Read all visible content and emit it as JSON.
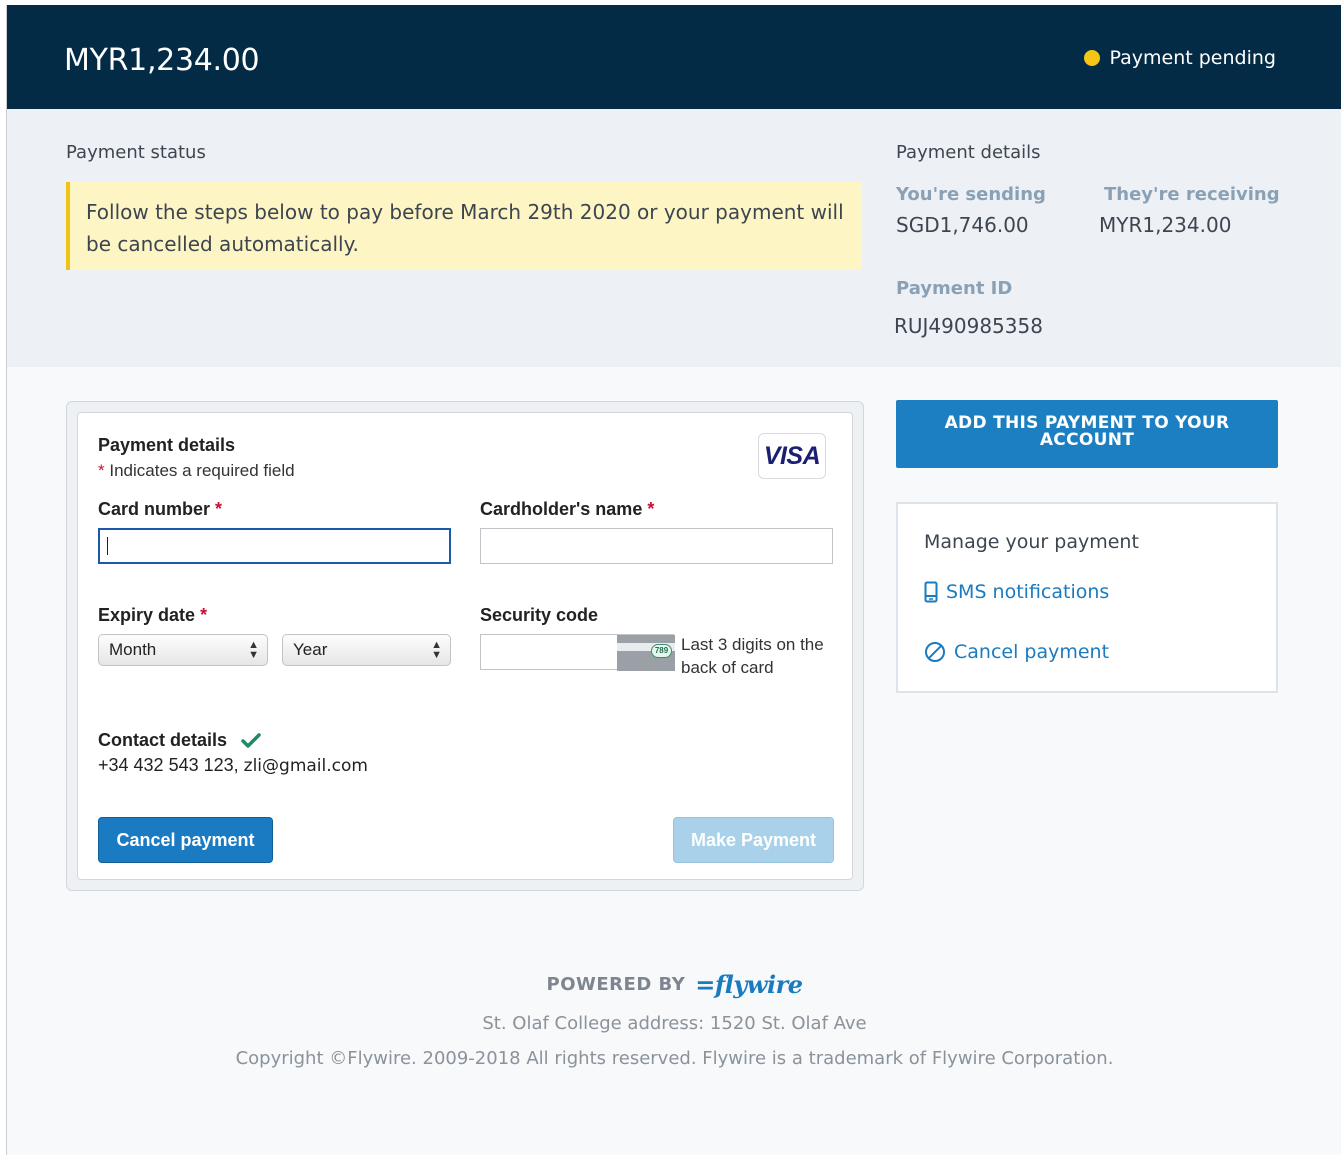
{
  "header": {
    "amount": "MYR1,234.00",
    "status": "Payment pending",
    "status_color": "#f5c518"
  },
  "summary": {
    "status_label": "Payment status",
    "notice": "Follow the steps below to pay before March 29th 2020 or your payment will be cancelled automatically.",
    "details_title": "Payment details",
    "sending_label": "You're sending",
    "sending_value": "SGD1,746.00",
    "receiving_label": "They're receiving",
    "receiving_value": "MYR1,234.00",
    "id_label": "Payment ID",
    "id_value": "RUJ490985358"
  },
  "form": {
    "title": "Payment details",
    "required_mark": "*",
    "required_note": "Indicates a required field",
    "card_brand": "VISA",
    "card_number_label": "Card number",
    "card_number_value": "",
    "cardholder_label": "Cardholder's name",
    "cardholder_value": "",
    "expiry_label": "Expiry date",
    "month_placeholder": "Month",
    "year_placeholder": "Year",
    "security_label": "Security code",
    "cvv_sample": "789",
    "security_hint": "Last 3 digits on the back of card",
    "contact_label": "Contact details",
    "contact_phone": "+34 432 543 123,",
    "contact_email": "zli@gmail.com",
    "cancel_button": "Cancel payment",
    "make_button": "Make Payment"
  },
  "sidebar": {
    "add_button": "ADD THIS PAYMENT TO YOUR ACCOUNT",
    "manage_title": "Manage your payment",
    "sms_link": "SMS notifications",
    "cancel_link": "Cancel payment"
  },
  "footer": {
    "powered_by": "POWERED BY",
    "brand": "flywire",
    "address": "St. Olaf College address: 1520 St. Olaf Ave",
    "copyright": "Copyright ©Flywire. 2009-2018 All rights reserved. Flywire is a trademark of Flywire Corporation."
  }
}
